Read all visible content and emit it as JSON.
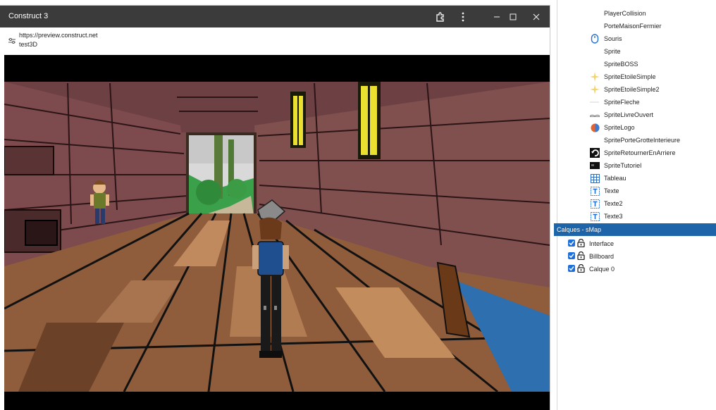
{
  "window": {
    "title": "Construct 3",
    "url": "https://preview.construct.net",
    "project": "test3D",
    "buttons": {
      "extension": "extension-icon",
      "more": "more-vert-icon",
      "minimize": "minimize-icon",
      "maximize": "maximize-icon",
      "close": "close-icon"
    }
  },
  "objects": [
    {
      "label": "PlayerCollision",
      "icon": "none"
    },
    {
      "label": "PorteMaisonFermier",
      "icon": "none"
    },
    {
      "label": "Souris",
      "icon": "mouse-icon"
    },
    {
      "label": "Sprite",
      "icon": "none"
    },
    {
      "label": "SpriteBOSS",
      "icon": "none"
    },
    {
      "label": "SpriteEtoileSimple",
      "icon": "star-icon"
    },
    {
      "label": "SpriteEtoileSimple2",
      "icon": "star-icon"
    },
    {
      "label": "SpriteFleche",
      "icon": "arrow-icon"
    },
    {
      "label": "SpriteLivreOuvert",
      "icon": "book-icon"
    },
    {
      "label": "SpriteLogo",
      "icon": "logo-icon"
    },
    {
      "label": "SpritePorteGrotteInterieure",
      "icon": "none"
    },
    {
      "label": "SpriteRetournerEnArriere",
      "icon": "back-icon"
    },
    {
      "label": "SpriteTutoriel",
      "icon": "tutorial-icon"
    },
    {
      "label": "Tableau",
      "icon": "grid-icon"
    },
    {
      "label": "Texte",
      "icon": "text-icon"
    },
    {
      "label": "Texte2",
      "icon": "text-icon"
    },
    {
      "label": "Texte3",
      "icon": "text-icon"
    }
  ],
  "layers": {
    "header": "Calques - sMap",
    "items": [
      {
        "label": "Interface",
        "checked": true,
        "locked": false
      },
      {
        "label": "Billboard",
        "checked": true,
        "locked": false
      },
      {
        "label": "Calque 0",
        "checked": true,
        "locked": false
      }
    ]
  },
  "colors": {
    "titlebar": "#3b3b3b",
    "layers_header": "#1e64a8",
    "checkbox": "#1e6fd9",
    "wall": "#7a4a4d",
    "floor_light": "#b07850",
    "floor_dark": "#5e3a24",
    "window_yellow": "#e9e030",
    "water": "#2e6fb0"
  }
}
